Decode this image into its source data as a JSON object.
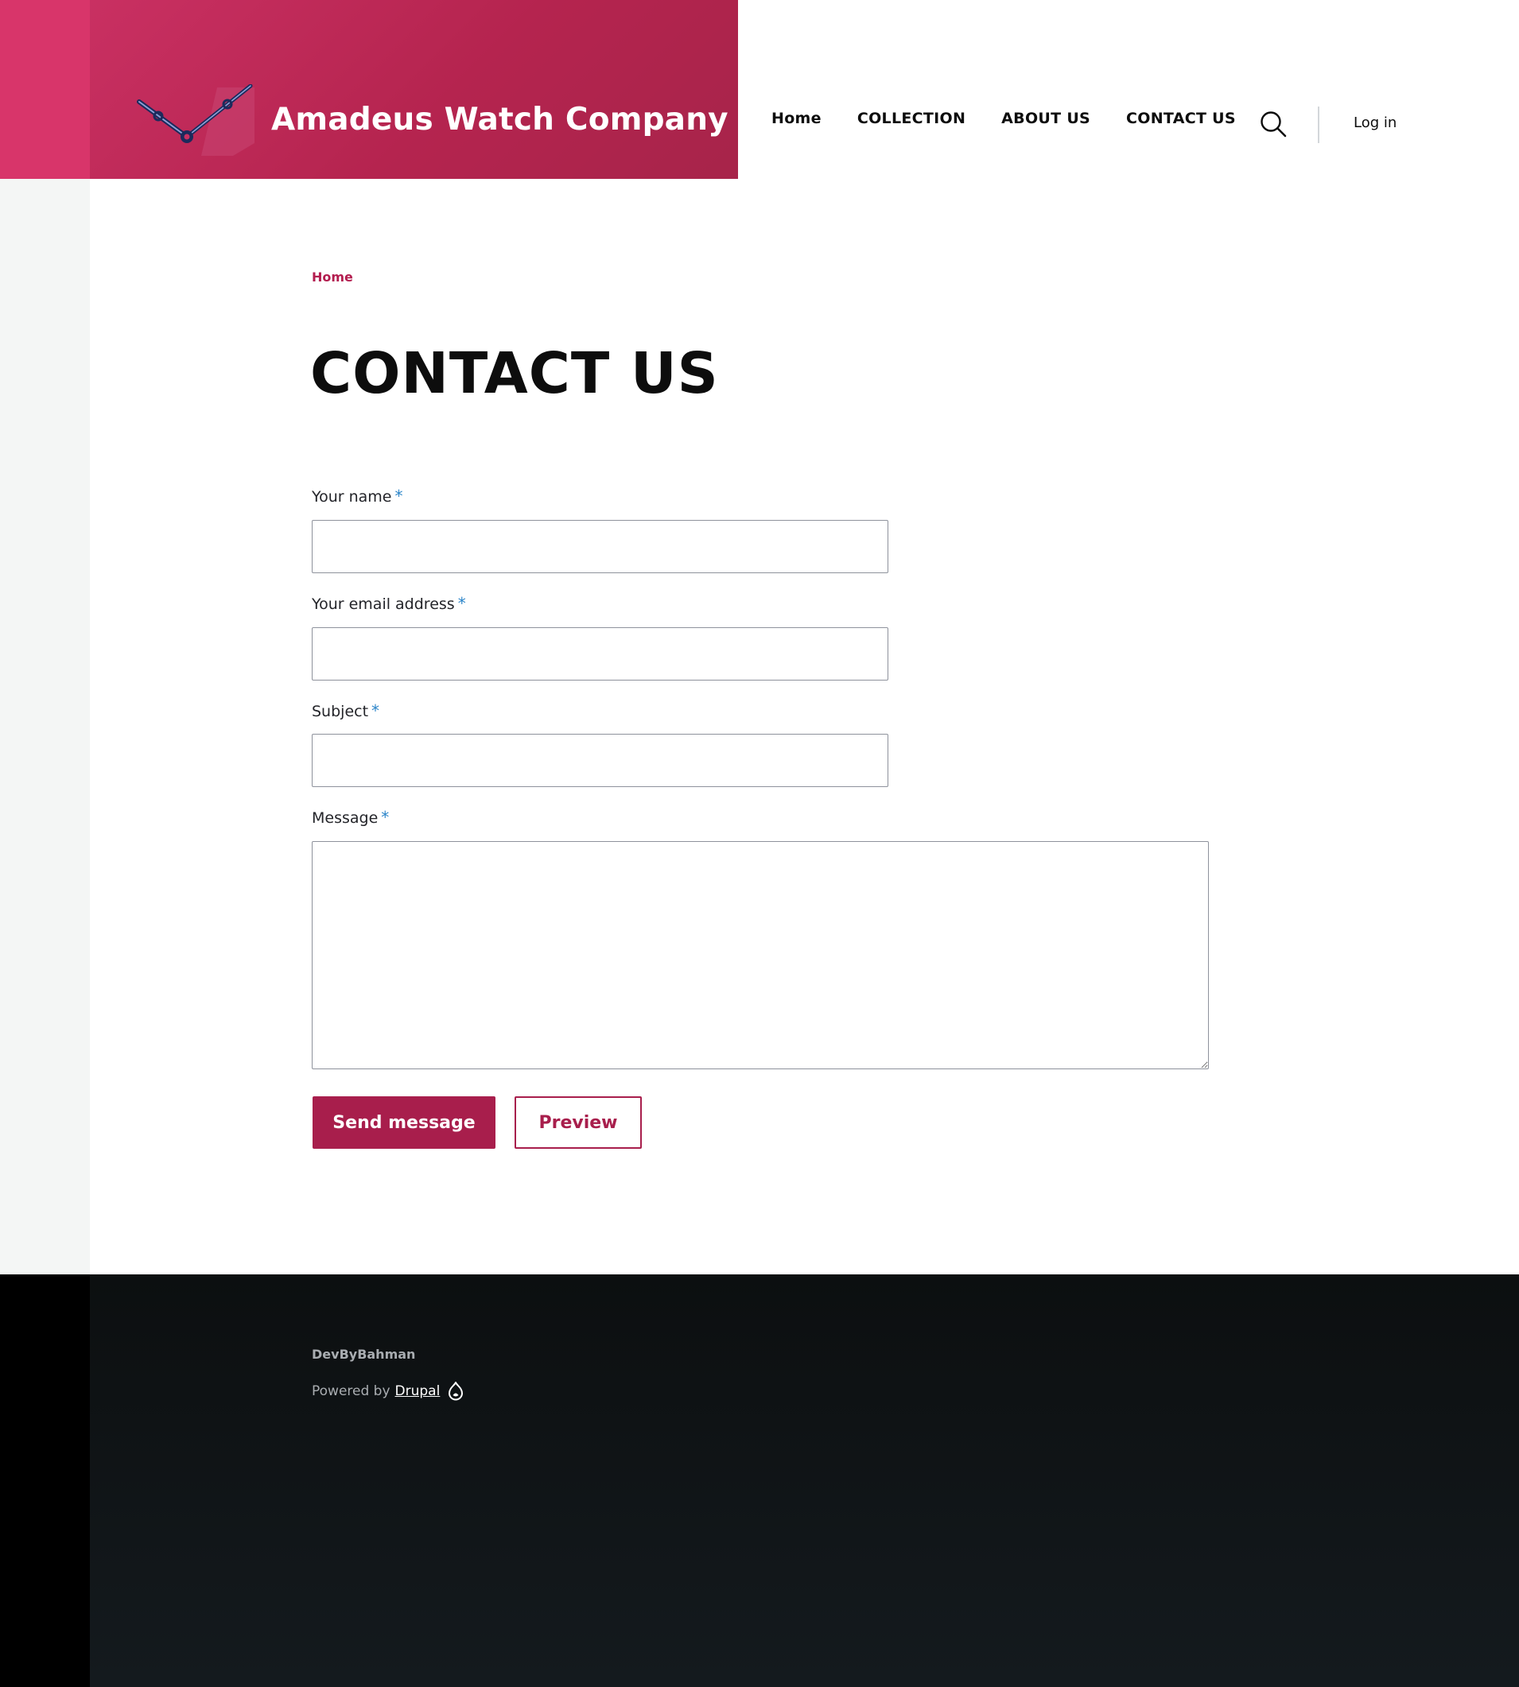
{
  "site": {
    "name": "Amadeus Watch Company",
    "brand_color": "#b5244f",
    "accent_color": "#a81e4c",
    "required_color": "#2c85c9"
  },
  "nav": {
    "items": [
      {
        "label": "Home"
      },
      {
        "label": "COLLECTION"
      },
      {
        "label": "ABOUT US"
      },
      {
        "label": "CONTACT US"
      }
    ],
    "search_icon": "search-icon",
    "login_label": "Log in"
  },
  "breadcrumb": {
    "home_label": "Home"
  },
  "page": {
    "title": "CONTACT US"
  },
  "form": {
    "required_marker": "*",
    "fields": {
      "name": {
        "label": "Your name",
        "value": ""
      },
      "email": {
        "label": "Your email address",
        "value": ""
      },
      "subject": {
        "label": "Subject",
        "value": ""
      },
      "message": {
        "label": "Message",
        "value": ""
      }
    },
    "send_label": "Send message",
    "preview_label": "Preview"
  },
  "footer": {
    "brand": "DevByBahman",
    "powered_by": "Powered by",
    "drupal_label": "Drupal",
    "drupal_icon": "drupal-icon"
  }
}
